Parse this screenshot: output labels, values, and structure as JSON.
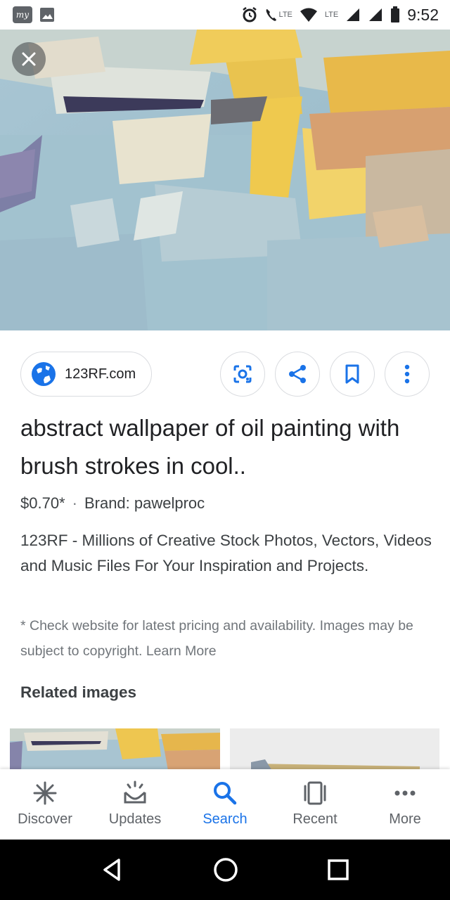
{
  "status_bar": {
    "time": "9:52",
    "app_badge": "my",
    "lte_label_1": "LTE",
    "lte_label_2": "LTE"
  },
  "source": {
    "label": "123RF.com"
  },
  "result": {
    "title": "abstract wallpaper of oil painting with brush strokes in cool..",
    "price": "$0.70*",
    "separator": "·",
    "brand": "Brand: pawelproc",
    "description": "123RF - Millions of Creative Stock Photos, Vectors, Videos and Music Files For Your Inspiration and Projects.",
    "disclaimer": "* Check website for latest pricing and availability. Images may be subject to copyright. Learn More"
  },
  "related": {
    "heading": "Related images"
  },
  "bottom_nav": {
    "items": [
      {
        "label": "Discover",
        "icon": "asterisk-icon"
      },
      {
        "label": "Updates",
        "icon": "inbox-updates-icon"
      },
      {
        "label": "Search",
        "icon": "search-icon"
      },
      {
        "label": "Recent",
        "icon": "recent-cards-icon"
      },
      {
        "label": "More",
        "icon": "more-dots-icon"
      }
    ],
    "active": "Search"
  },
  "colors": {
    "accent": "#1a73e8",
    "text": "#202124",
    "secondary_text": "#3c4043",
    "muted_text": "#70757a",
    "border": "#dadce0"
  }
}
